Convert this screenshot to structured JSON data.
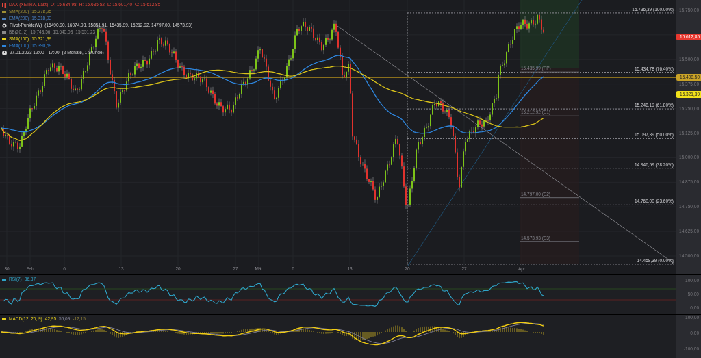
{
  "legend": [
    {
      "kind": "symbol",
      "label": "DAX (XETRA, Last)",
      "color": "#e0453a",
      "values": [
        "O: 15.634,98",
        "H: 15.635,52",
        "L: 15.601,40",
        "C: 15.612,85"
      ]
    },
    {
      "kind": "indicator",
      "label": "SMA(200)",
      "color": "#a08f34",
      "values": [
        "15.278,25"
      ]
    },
    {
      "kind": "indicator",
      "label": "EMA(200)",
      "color": "#4a7fc0",
      "values": [
        "15.318,93"
      ]
    },
    {
      "kind": "pivot",
      "label": "Pivot-Punkte(W)",
      "color": "#d8d8d8",
      "values": [
        "(16490.90, 16074.98, 15851.91, 15435.99, 15212.92, 14797.00, 14573.93)"
      ]
    },
    {
      "kind": "indicator",
      "label": "BB(20, 2)",
      "color": "#8a8a8a",
      "values": [
        "15.743,56",
        "15.645,03",
        "15.551,23"
      ]
    },
    {
      "kind": "indicator",
      "label": "SMA(100)",
      "color": "#e8d21a",
      "values": [
        "15.321,39"
      ]
    },
    {
      "kind": "indicator",
      "label": "EMA(100)",
      "color": "#2e86de",
      "values": [
        "15.390,59"
      ]
    },
    {
      "kind": "range",
      "label": "27.01.2023 12:00 - 17:00",
      "color": "#d8d8d8",
      "values": [
        "(2 Monate, 1 Stunde)"
      ]
    }
  ],
  "price_axis": {
    "labels": [
      "15.750,00",
      "15.500,00",
      "15.375,00",
      "15.250,00",
      "15.125,00",
      "15.000,00",
      "14.875,00",
      "14.750,00",
      "14.625,00",
      "14.500,00"
    ]
  },
  "price_tags": [
    {
      "text": "15.612,85",
      "color": "#e8382f"
    },
    {
      "text": "15.408,50",
      "color": "#c9a227"
    },
    {
      "text": "15.321,39",
      "color": "#f2e21b"
    }
  ],
  "fibonacci": {
    "levels": [
      "15.736,39 (100.00%)",
      "15.434,78 (76.40%)",
      "15.248,19 (61.80%)",
      "15.097,39 (50.00%)",
      "14.946,59 (38.20%)",
      "14.760,00 (23.60%)",
      "14.458,39 (0.00%)"
    ]
  },
  "pivots": {
    "levels": [
      "15.435,99 (PP)",
      "15.212,92 (S1)",
      "14.797,00 (S2)",
      "14.573,93 (S3)"
    ]
  },
  "time_axis": {
    "labels": [
      "30",
      "Feb",
      "6",
      "13",
      "20",
      "27",
      "Mär",
      "6",
      "13",
      "20",
      "27",
      "Apr"
    ]
  },
  "rsi": {
    "title": "RSI(7)",
    "value": "36,87",
    "axis_labels": [
      "100,00",
      "50,00",
      "0,00"
    ]
  },
  "macd": {
    "title": "MACD(12, 26, 9)",
    "values": [
      "42,95",
      "55,09",
      "-12,15"
    ],
    "axis_labels": [
      "100,00",
      "0,00",
      "-100,00"
    ]
  }
}
